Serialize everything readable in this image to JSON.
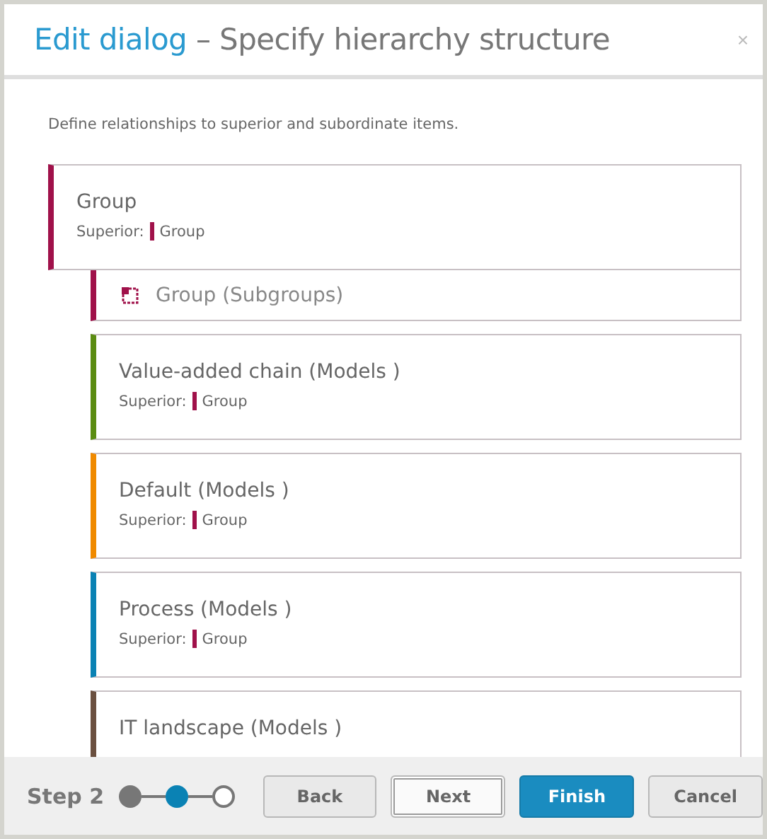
{
  "dialog": {
    "title_lead": "Edit dialog",
    "title_rest": "– Specify hierarchy structure",
    "close": "×"
  },
  "intro": "Define relationships to superior and subordinate items.",
  "items": [
    {
      "kind": "parent",
      "title": "Group",
      "color": "#a0114a",
      "superior_label": "Superior:",
      "superior": {
        "name": "Group",
        "color": "#a0114a"
      }
    },
    {
      "kind": "subgroup",
      "title": "Group (Subgroups)",
      "color": "#a0114a"
    },
    {
      "kind": "child",
      "title": "Value-added chain (Models )",
      "color": "#5b8c12",
      "superior_label": "Superior:",
      "superior": {
        "name": "Group",
        "color": "#a0114a"
      }
    },
    {
      "kind": "child",
      "title": "Default (Models )",
      "color": "#f08a00",
      "superior_label": "Superior:",
      "superior": {
        "name": "Group",
        "color": "#a0114a"
      }
    },
    {
      "kind": "child",
      "title": "Process (Models )",
      "color": "#0a82b4",
      "superior_label": "Superior:",
      "superior": {
        "name": "Group",
        "color": "#a0114a"
      }
    },
    {
      "kind": "child",
      "title": "IT landscape (Models )",
      "color": "#6b5040"
    }
  ],
  "footer": {
    "step_label": "Step 2",
    "steps": [
      {
        "completed": true,
        "selected": false
      },
      {
        "completed": true,
        "selected": true
      },
      {
        "completed": false,
        "selected": false
      }
    ],
    "buttons": [
      {
        "label": "Back",
        "kind": "default"
      },
      {
        "label": "Next",
        "kind": "focused"
      },
      {
        "label": "Finish",
        "kind": "primary"
      },
      {
        "label": "Cancel",
        "kind": "default"
      }
    ]
  }
}
